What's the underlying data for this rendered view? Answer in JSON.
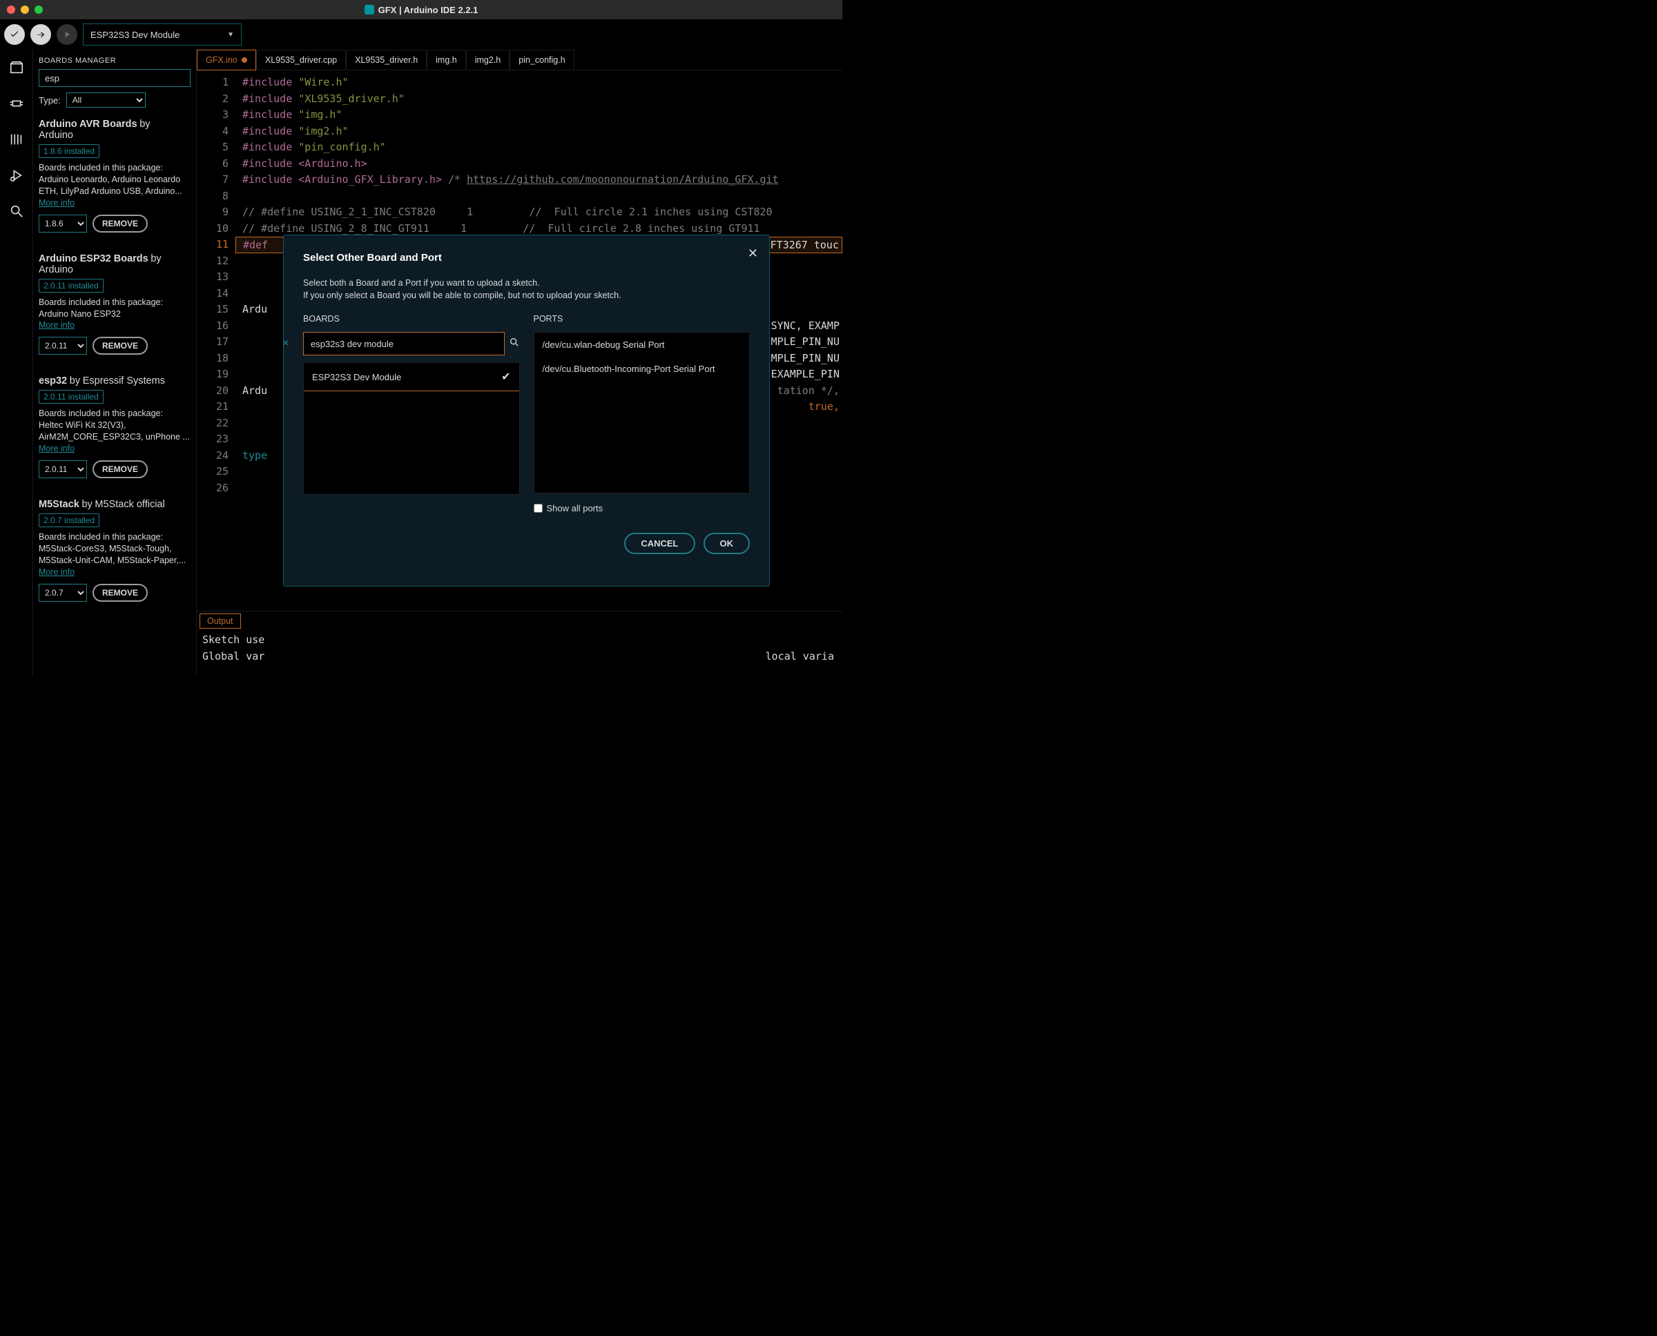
{
  "titlebar": {
    "title": "GFX | Arduino IDE 2.2.1"
  },
  "toolbar": {
    "board_selector": "ESP32S3 Dev Module"
  },
  "boards_manager": {
    "title": "BOARDS MANAGER",
    "search_value": "esp",
    "type_label": "Type:",
    "type_value": "All",
    "cards": [
      {
        "name": "Arduino AVR Boards",
        "by_label": "by",
        "author": "Arduino",
        "installed_tag": "1.8.6 installed",
        "desc": "Boards included in this package:\nArduino Leonardo, Arduino Leonardo ETH, LilyPad Arduino USB, Arduino...",
        "more": "More info",
        "version": "1.8.6",
        "remove": "REMOVE"
      },
      {
        "name": "Arduino ESP32 Boards",
        "by_label": "by",
        "author": "Arduino",
        "installed_tag": "2.0.11 installed",
        "desc": "Boards included in this package:\nArduino Nano ESP32",
        "more": "More info",
        "version": "2.0.11",
        "remove": "REMOVE"
      },
      {
        "name": "esp32",
        "by_label": "by",
        "author": "Espressif Systems",
        "installed_tag": "2.0.11 installed",
        "desc": "Boards included in this package:\nHeltec WiFi Kit 32(V3), AirM2M_CORE_ESP32C3, unPhone ...",
        "more": "More info",
        "version": "2.0.11",
        "remove": "REMOVE"
      },
      {
        "name": "M5Stack",
        "by_label": "by",
        "author": "M5Stack official",
        "installed_tag": "2.0.7 installed",
        "desc": "Boards included in this package:\nM5Stack-CoreS3, M5Stack-Tough, M5Stack-Unit-CAM, M5Stack-Paper,...",
        "more": "More info",
        "version": "2.0.7",
        "remove": "REMOVE"
      }
    ]
  },
  "tabs": [
    "GFX.ino",
    "XL9535_driver.cpp",
    "XL9535_driver.h",
    "img.h",
    "img2.h",
    "pin_config.h"
  ],
  "code": {
    "gutter_start": 1,
    "gutter_end": 26,
    "l1": "#include \"Wire.h\"",
    "l2": "#include \"XL9535_driver.h\"",
    "l3": "#include \"img.h\"",
    "l4": "#include \"img2.h\"",
    "l5": "#include \"pin_config.h\"",
    "l6": "#include <Arduino.h>",
    "l7_a": "#include <Arduino_GFX_Library.h> ",
    "l7_b": "/* ",
    "l7_c": "https://github.com/moononournation/Arduino_GFX.git",
    "l9": "// #define USING_2_1_INC_CST820     1         //  Full circle 2.1 inches using CST820",
    "l10": "// #define USING_2_8_INC_GT911     1         //  Full circle 2.8 inches using GT911",
    "l11_a": "#def",
    "l11_b": "FT3267 touc",
    "l15": "Ardu",
    "l16_b": "SYNC, EXAMP",
    "l17_b": "MPLE_PIN_NU",
    "l18_b": "MPLE_PIN_NU",
    "l19_b": "EXAMPLE_PIN",
    "l20_a": "Ardu",
    "l20_b": "tation */,",
    "l21_b": "true,",
    "l24": "type"
  },
  "output": {
    "tab": "Output",
    "l1": "Sketch use",
    "l2": "Global var",
    "l2_b": "local varia"
  },
  "modal": {
    "title": "Select Other Board and Port",
    "desc1": "Select both a Board and a Port if you want to upload a sketch.",
    "desc2": "If you only select a Board you will be able to compile, but not to upload your sketch.",
    "boards_label": "BOARDS",
    "ports_label": "PORTS",
    "search_value": "esp32s3 dev module",
    "board_item": "ESP32S3 Dev Module",
    "port_items": [
      "/dev/cu.wlan-debug Serial Port",
      "/dev/cu.Bluetooth-Incoming-Port Serial Port"
    ],
    "show_all_ports": "Show all ports",
    "cancel": "CANCEL",
    "ok": "OK"
  }
}
